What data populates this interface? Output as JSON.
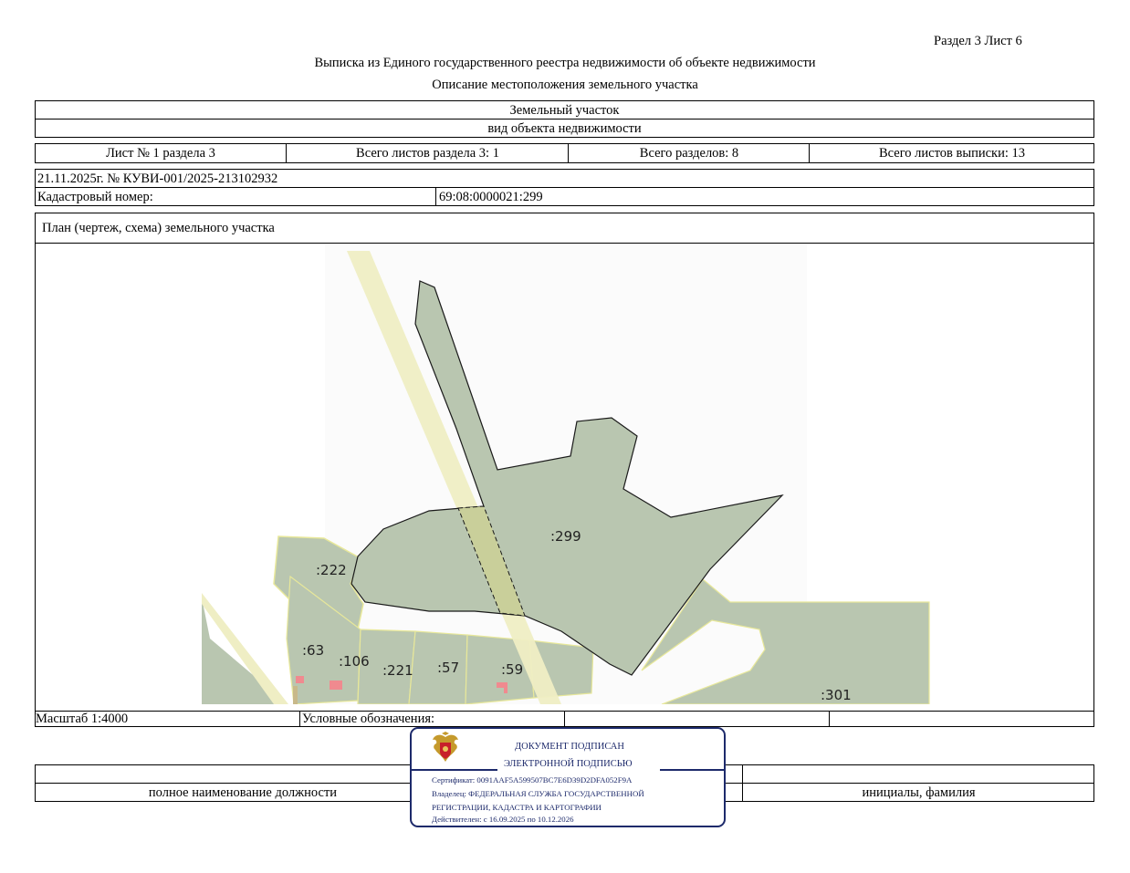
{
  "header": {
    "section_sheet": "Раздел 3    Лист 6",
    "title": "Выписка из Единого государственного реестра недвижимости об объекте недвижимости",
    "subtitle": "Описание местоположения земельного участка"
  },
  "object": {
    "type": "Земельный участок",
    "type_caption": "вид объекта недвижимости"
  },
  "sheets": {
    "sheet_of_section": "Лист № 1 раздела 3",
    "total_section_sheets": "Всего листов раздела 3: 1",
    "total_sections": "Всего разделов: 8",
    "total_extract_sheets": "Всего листов выписки: 13"
  },
  "extract": {
    "date_number": "21.11.2025г. № КУВИ-001/2025-213102932",
    "cadastral_label": "Кадастровый номер:",
    "cadastral_number": "69:08:0000021:299"
  },
  "plan": {
    "title": "План (чертеж, схема) земельного участка",
    "parcel_labels": {
      "p299": ":299",
      "p222": ":222",
      "p63": ":63",
      "p106": ":106",
      "p221": ":221",
      "p57": ":57",
      "p59": ":59",
      "p301": ":301"
    },
    "colors": {
      "target_parcel": "#b9c6b0",
      "neighbor_parcel": "#b9c6b0",
      "road_strip": "#efeec4",
      "building": "#f08a8f"
    }
  },
  "footer": {
    "scale": "Масштаб 1:4000",
    "legend": "Условные обозначения:",
    "position_caption": "полное наименование должности",
    "initials_caption": "инициалы, фамилия"
  },
  "stamp": {
    "line1": "ДОКУМЕНТ ПОДПИСАН",
    "line2": "ЭЛЕКТРОННОЙ ПОДПИСЬЮ",
    "certificate": "Сертификат: 0091AAF5A599507BC7E6D39D2DFA052F9A",
    "owner1": "Владелец: ФЕДЕРАЛЬНАЯ СЛУЖБА ГОСУДАРСТВЕННОЙ",
    "owner2": "РЕГИСТРАЦИИ, КАДАСТРА И КАРТОГРАФИИ",
    "valid": "Действителен: с 16.09.2025 по 10.12.2026",
    "color": "#1d2a6b"
  }
}
